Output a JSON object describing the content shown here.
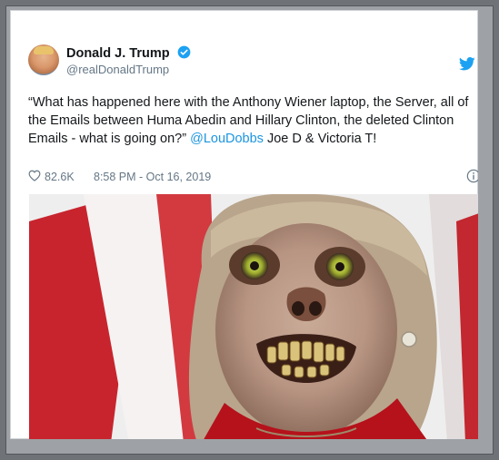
{
  "tweet": {
    "author_name": "Donald J. Trump",
    "handle": "@realDonaldTrump",
    "text_before": "“What has happened here with the Anthony Wiener laptop, the Server, all of the Emails between Huma Abedin and Hillary Clinton, the deleted Clinton Emails - what is going on?” ",
    "mention": "@LouDobbs",
    "text_after": "  Joe D & Victoria T!",
    "likes": "82.6K",
    "timestamp": "8:58 PM - Oct 16, 2019"
  },
  "icons": {
    "verified": "verified-badge-icon",
    "bird": "twitter-bird-icon",
    "heart": "heart-icon",
    "info": "info-icon"
  },
  "colors": {
    "brand_blue": "#1da1f2",
    "text": "#14171a",
    "secondary": "#657786",
    "link": "#1b95e0"
  }
}
